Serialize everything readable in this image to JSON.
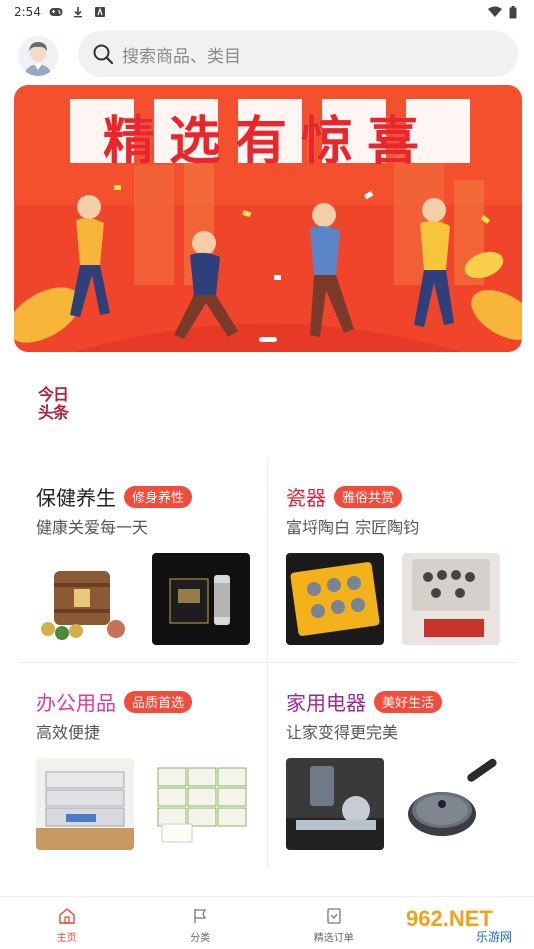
{
  "status_bar": {
    "time": "2:54"
  },
  "search": {
    "placeholder": "搜索商品、类目"
  },
  "banner": {
    "title": "精选有惊喜"
  },
  "headline": {
    "line1": "今日",
    "line2": "头条"
  },
  "categories": [
    {
      "title": "保健养生",
      "tag": "修身养性",
      "subtitle": "健康关爱每一天",
      "title_color": "#222222"
    },
    {
      "title": "瓷器",
      "tag": "雅俗共赏",
      "subtitle": "富埒陶白 宗匠陶钧",
      "title_color": "#e0243c"
    },
    {
      "title": "办公用品",
      "tag": "品质首选",
      "subtitle": "高效便捷",
      "title_color": "#e03a9a"
    },
    {
      "title": "家用电器",
      "tag": "美好生活",
      "subtitle": "让家变得更完美",
      "title_color": "#9a2a9a"
    }
  ],
  "bottom_nav": [
    {
      "label": "主页",
      "icon": "home-icon",
      "active": true
    },
    {
      "label": "分类",
      "icon": "category-icon",
      "active": false
    },
    {
      "label": "精选订单",
      "icon": "order-icon",
      "active": false
    }
  ],
  "watermark": {
    "brand": "962.NET",
    "sub": "乐游网"
  },
  "colors": {
    "accent": "#f24d3c",
    "banner_bg": "#f5502e"
  }
}
